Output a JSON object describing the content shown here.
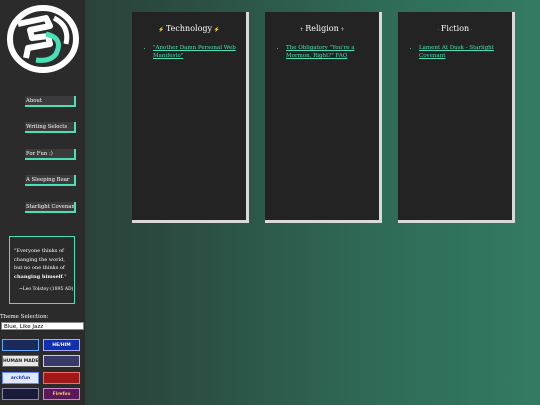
{
  "nav": {
    "items": [
      {
        "label": "About"
      },
      {
        "label": "Writing Selects"
      },
      {
        "label": "For Fun :)"
      },
      {
        "label": "A Sleeping Bear"
      },
      {
        "label": "Starlight Covenant"
      }
    ]
  },
  "quote": {
    "text_start": "\"Everyone thinks of changing the world, but no one thinks of ",
    "text_bold": "changing himself",
    "text_end": ".\"",
    "attribution": "~Leo Tolstoy (1895 AD)"
  },
  "theme": {
    "label": "Theme Selection:",
    "selected": "Blue, Like Jazz"
  },
  "badges": [
    {
      "text": "",
      "icon": "dark-banner-icon"
    },
    {
      "text": "HE/HIM",
      "icon": "text-badge"
    },
    {
      "text": "HUMAN MADE",
      "icon": "text-badge"
    },
    {
      "text": "",
      "icon": "screen-banner-icon"
    },
    {
      "text": "archfun",
      "icon": "text-badge"
    },
    {
      "text": "",
      "icon": "red-banner-icon"
    },
    {
      "text": "",
      "icon": "dark-banner-icon"
    },
    {
      "text": "Firefox",
      "icon": "firefox-icon"
    }
  ],
  "panels": [
    {
      "title": "Technology",
      "links": [
        "\"Another Damn Personal Web Manifesto\""
      ]
    },
    {
      "title": "Religion",
      "links": [
        "The Obligatory \"You're a Mormon, Right?\" FAQ"
      ]
    },
    {
      "title": "Fiction",
      "links": [
        "Lament At Dusk - Starlight Covenant"
      ]
    }
  ],
  "colors": {
    "accent": "#49e0b8",
    "sidebar": "#2b2b2b",
    "panel": "#232323"
  }
}
